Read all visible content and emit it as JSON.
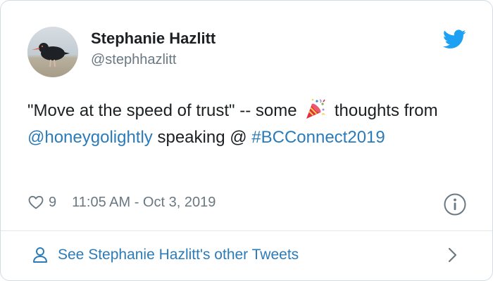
{
  "author": {
    "name": "Stephanie Hazlitt",
    "handle": "@stephhazlitt"
  },
  "tweet": {
    "text_part1": "\"Move at the speed of trust\" -- some",
    "emoji": "party-popper-emoji",
    "text_part2": "thoughts from",
    "mention": "@honeygolightly",
    "text_part3": "speaking @",
    "hashtag": "#BCConnect2019"
  },
  "meta": {
    "likes": "9",
    "timestamp": "11:05 AM - Oct 3, 2019"
  },
  "footer": {
    "link_label": "See Stephanie Hazlitt's other Tweets"
  },
  "icons": {
    "brand": "twitter-bird-icon",
    "like": "heart-icon",
    "info": "info-icon",
    "person": "person-icon",
    "chevron": "chevron-right-icon"
  },
  "colors": {
    "link": "#2b7bb9",
    "brand": "#1da1f2",
    "secondary_text": "#697882"
  }
}
